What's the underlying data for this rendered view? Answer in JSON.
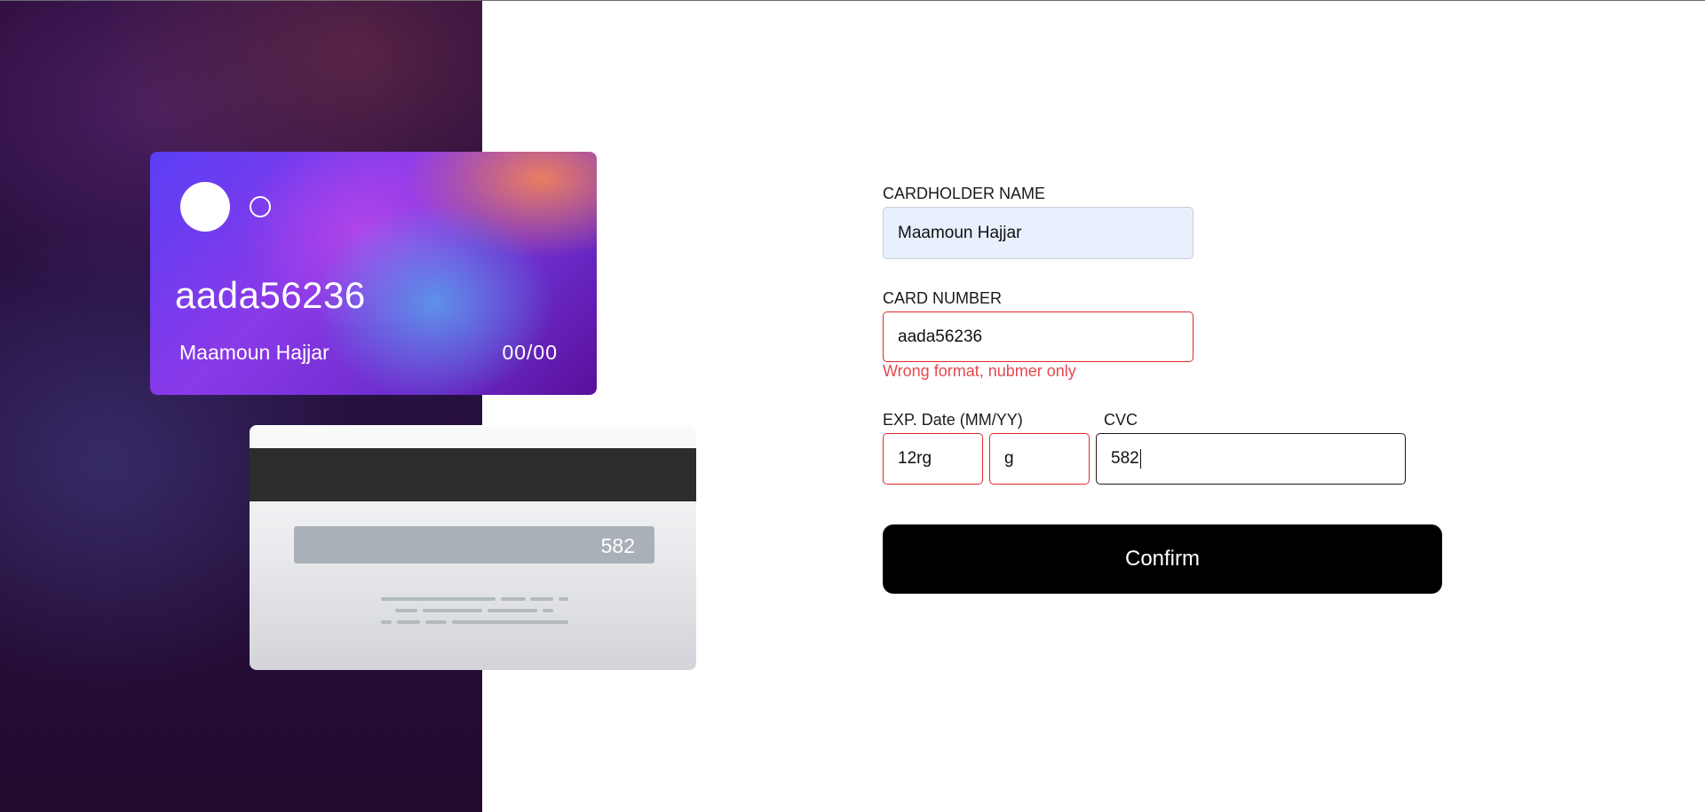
{
  "card_front": {
    "number": "aada56236",
    "name": "Maamoun Hajjar",
    "exp": "00/00"
  },
  "card_back": {
    "cvc": "582"
  },
  "form": {
    "name": {
      "label": "CARDHOLDER NAME",
      "value": "Maamoun Hajjar"
    },
    "number": {
      "label": "CARD NUMBER",
      "value": "aada56236",
      "error": "Wrong format, nubmer only"
    },
    "exp": {
      "label": "EXP. Date (MM/YY)",
      "month_value": "12rg",
      "year_value": "g"
    },
    "cvc": {
      "label": "CVC",
      "value": "582"
    },
    "confirm_label": "Confirm"
  },
  "colors": {
    "error": "#e0282c",
    "error_text": "#e5484d",
    "autofill_bg": "#e8f0fe",
    "button_bg": "#000000"
  }
}
